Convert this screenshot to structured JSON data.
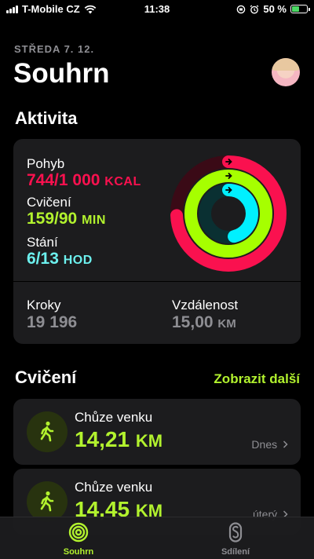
{
  "status_bar": {
    "carrier": "T-Mobile CZ",
    "time": "11:38",
    "battery": "50 %",
    "battery_level": 0.5
  },
  "header": {
    "date": "STŘEDA 7. 12.",
    "title": "Souhrn"
  },
  "activity": {
    "section_title": "Aktivita",
    "move": {
      "label": "Pohyb",
      "value": "744/1 000",
      "unit": "KCAL",
      "color": "#fa114f",
      "progress": 0.744
    },
    "exercise": {
      "label": "Cvičení",
      "value": "159/90",
      "unit": "MIN",
      "color": "#a6ff00",
      "progress": 1.767
    },
    "stand": {
      "label": "Stání",
      "value": "6/13",
      "unit": "HOD",
      "color": "#00f0ff",
      "progress": 0.4615
    },
    "steps": {
      "label": "Kroky",
      "value": "19 196"
    },
    "distance": {
      "label": "Vzdálenost",
      "value": "15,00",
      "unit": "KM"
    }
  },
  "workouts": {
    "section_title": "Cvičení",
    "show_more": "Zobrazit další",
    "items": [
      {
        "name": "Chůze venku",
        "distance": "14,21",
        "unit": "KM",
        "date": "Dnes"
      },
      {
        "name": "Chůze venku",
        "distance": "14,45",
        "unit": "KM",
        "date": "úterý"
      }
    ]
  },
  "tab_bar": {
    "tabs": [
      {
        "label": "Souhrn",
        "active": true
      },
      {
        "label": "Sdílení",
        "active": false
      }
    ],
    "accent_color": "#b2f22e"
  }
}
